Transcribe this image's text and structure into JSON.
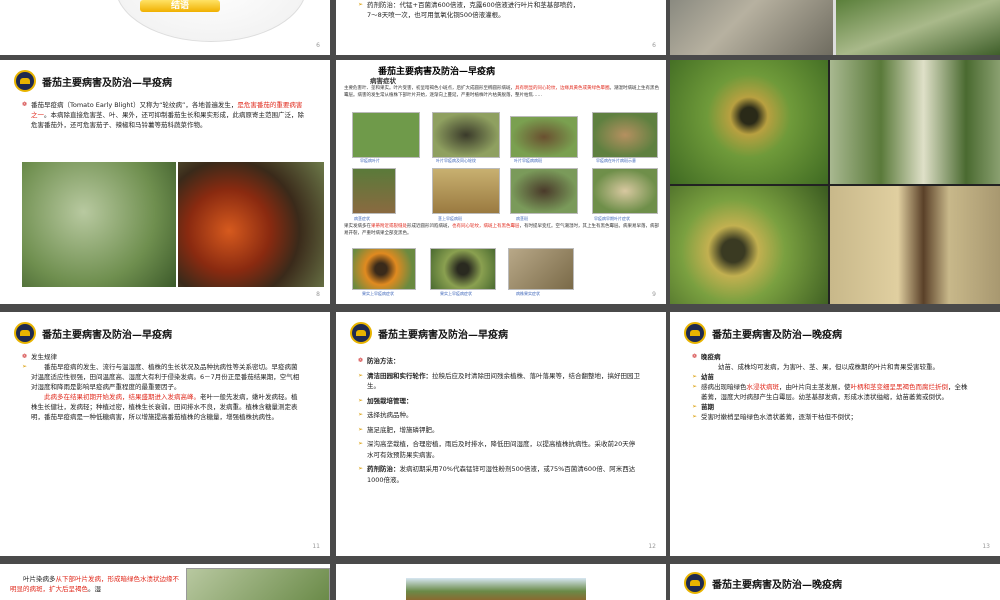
{
  "slides": {
    "s1": {
      "button_label": "结语",
      "page": "6"
    },
    "s2": {
      "line1": "药剂防治：代锰+百菌清600倍液，克露600倍液进行叶片和茎基部喷药，",
      "line2": "7～8天喷一次，也可用氢氧化铜500倍液灌根。",
      "page": "6"
    },
    "s3": {
      "page": ""
    },
    "s4": {
      "title": "番茄主要病害及防治—早疫病",
      "p_a": "番茄早疫病（Tomato Early Blight）又称为“轮纹病”，各地普遍发生，",
      "p_red": "是危害番茄的重要病害之一",
      "p_b": "。本病除直接危害茎、叶、果外，还可抑制番茄生长和果实形成，此病原寄主范围广泛，除危害番茄外，还可危害茄子、辣椒和马铃薯等茄科蔬菜作物。",
      "page": "8"
    },
    "s5": {
      "title": "番茄主要病害及防治—早疫病",
      "subtitle": "病害症状",
      "text_a": "主要危害叶、茎和果实。叶片受害，初呈暗褐色小斑点，后扩大成圆形至椭圆形病斑，",
      "text_red": "具有明显的同心轮纹，边缘具黄色或黄绿色晕圈",
      "text_b": "。潮湿时病斑上生有黑色霉层。病害的发生常从植株下部叶片开始，逐渐向上蔓延，严重时植株叶片枯黄脱落，整片枯焦……",
      "captions1": [
        "早疫病叶片",
        "叶片早疫病及同心轮纹",
        "叶片早疫病病斑",
        "早疫病在叶片病斑示意"
      ],
      "captions2": [
        "病茎症状",
        "茎上早疫病斑",
        "病茎斑",
        "早疫病早期叶片症状"
      ],
      "text2_a": "果实发病多在",
      "text2_red": "果蒂附近或裂缝处",
      "text2_b": "形成近圆形凹陷病斑，",
      "text2_red2": "也有同心轮纹，病斑上有黑色霉层",
      "text2_c": "，有时提早变红。空气潮湿时，其上生有黑色霉层。病果易早落，病部易开裂，严重时病果全部变黑色。",
      "captions3": [
        "果实上早疫病症状",
        "果实上早疫病症状",
        "病株果实症状"
      ],
      "page": "9"
    },
    "s6": {
      "page": ""
    },
    "s7": {
      "title": "番茄主要病害及防治—早疫病",
      "heading": "发生规律",
      "p1": "番茄早疫病的发生、流行与温湿度、植株的生长状况及品种抗病性等关系密切。早疫病菌对温度适应性很强，田间温度高、湿度大有利于侵染发病。6－7月份正是番茄结果期，空气相对湿度和降雨是影响早疫病严重程度的最重要因子。",
      "p2_red": "此病多在结果初期开始发病，结果盛期进入发病高峰。",
      "p2": "老叶一般先发病，嫩叶发病轻。植株生长健壮，发病轻；种植过密，植株生长衰弱，田间排水不良，发病重。植株含糖量测定表明，番茄早疫病是一种低糖病害，所以增施提高番茄植株的含糖量，增强植株抗病性。",
      "page": "11"
    },
    "s8": {
      "title": "番茄主要病害及防治—早疫病",
      "heading": "防治方法：",
      "items": [
        {
          "label": "清洁田园和实行轮作：",
          "text": "拉秧后应及时清除田间残余植株、落叶落果等，结合翻整地，搞好田园卫生。"
        },
        {
          "label": "加强栽培管理：",
          "text": ""
        },
        {
          "label": "",
          "text": "选择抗病品种。"
        },
        {
          "label": "",
          "text": "施足底肥，增施磷钾肥。"
        },
        {
          "label": "",
          "text": "深沟高垄栽植，合理密植，雨后及时排水，降低田间湿度，以提高植株抗病性。采收前20天停水可有效预防果实病害。"
        },
        {
          "label": "药剂防治：",
          "text": "发病初期采用70%代森锰锌可湿性粉剂500倍液，或75%百菌清600倍、阿米西达1000倍液。"
        }
      ],
      "page": "12"
    },
    "s9": {
      "title": "番茄主要病害及防治—晚疫病",
      "heading": "晚疫病",
      "p1": "幼苗、成株均可发病，为害叶、茎、果，但以成株期的叶片和青果受害较重。",
      "h2": "幼苗",
      "p2_a": "感病出现暗绿色",
      "p2_red": "水浸状病斑",
      "p2_b": "，由叶片向主茎发展，使",
      "p2_red2": "叶柄和茎变细呈黑褐色而腐烂折倒",
      "p2_c": "，全株萎蔫，湿度大时病部产生白霉层。幼茎基部发病，形成水渍状缢缩，幼苗萎蔫或倒伏。",
      "h3": "苗期",
      "p3": "受害时嫩梢呈暗绿色水渍状萎蔫，逐渐干枯但不倒伏；",
      "page": "13"
    },
    "s10": {
      "text_a": "叶片染病多",
      "text_red": "从下部叶片发病，形成暗绿色水渍状边缘不明显的病斑，扩大后呈褐色",
      "text_b": "。湿",
      "page": ""
    },
    "s11": {
      "page": ""
    },
    "s12": {
      "title": "番茄主要病害及防治—晚疫病",
      "page": ""
    }
  }
}
